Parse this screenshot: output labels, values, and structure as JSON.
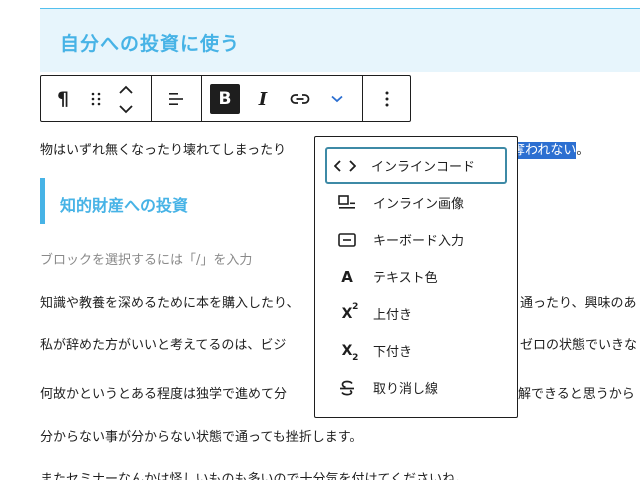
{
  "heading2": "自分への投資に使う",
  "toolbar": {
    "paragraph_icon": "¶",
    "bold_label": "B",
    "italic_label": "I"
  },
  "paragraph1": {
    "before": "物はいずれ無くなったり壊れてしまったり",
    "highlight": "奪われない",
    "after": "。"
  },
  "heading3": "知的財産への投資",
  "placeholder": "ブロックを選択するには「/」を入力",
  "rows": [
    {
      "left": "知識や教養を深めるために本を購入したり、",
      "right": "通ったり、興味のあ"
    },
    {
      "left": "私が辞めた方がいいと考えてるのは、ビジ",
      "right": "ゼロの状態でいきな"
    },
    {
      "left": "何故かというとある程度は独学で進めて分",
      "right": "解できると思うから"
    },
    {
      "left": "分からない事が分からない状態で通っても挫折します。",
      "right": ""
    },
    {
      "left": "またセミナーなんかは怪しいものも多いので十分気を付けてくださいね。",
      "right": ""
    }
  ],
  "dropdown": {
    "items": [
      {
        "label": "インラインコード",
        "icon": "code-icon"
      },
      {
        "label": "インライン画像",
        "icon": "inline-image-icon"
      },
      {
        "label": "キーボード入力",
        "icon": "keyboard-icon"
      },
      {
        "label": "テキスト色",
        "icon": "text-color-icon",
        "glyph": "A"
      },
      {
        "label": "上付き",
        "icon": "superscript-icon",
        "glyph": "X",
        "sub": "2"
      },
      {
        "label": "下付き",
        "icon": "subscript-icon",
        "glyph": "X",
        "sub": "2"
      },
      {
        "label": "取り消し線",
        "icon": "strikethrough-icon"
      }
    ]
  },
  "colors": {
    "accent": "#47b3e6",
    "heading_bg": "#e7f5fc",
    "selection": "#2c6fd1",
    "focus": "#3e8aa6"
  }
}
